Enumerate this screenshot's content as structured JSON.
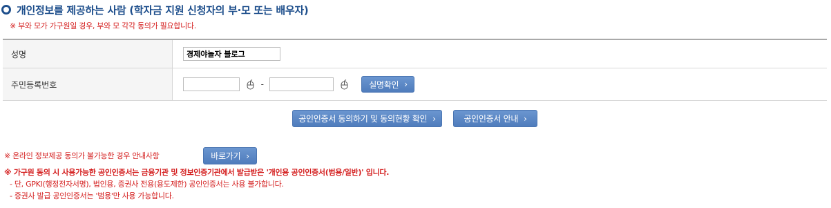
{
  "header": {
    "title": "개인정보를 제공하는 사람 (학자금 지원 신청자의 부·모 또는 배우자)",
    "note": "※ 부와 모가 가구원일 경우, 부와 모 각각 동의가 필요합니다."
  },
  "form": {
    "name_label": "성명",
    "name_value": "경제야놀자 블로그",
    "rrn_label": "주민등록번호",
    "rrn_separator": "-",
    "rrn_front": "",
    "rrn_back": "",
    "verify_button": "실명확인"
  },
  "actions": {
    "consent_button": "공인인증서 동의하기 및 동의현황 확인",
    "guide_button": "공인인증서 안내"
  },
  "offline": {
    "text": "※ 온라인 정보제공 동의가 불가능한 경우 안내사항",
    "goto_button": "바로가기"
  },
  "notes": {
    "main": "※ 가구원 동의 시 사용가능한 공인인증서는 금융기관 및 정보인증기관에서 발급받은 '개인용 공인인증서(범용/일반)' 입니다.",
    "sub1": "- 단, GPKI(행정전자서명), 법인용, 증권사 전용(용도제한) 공인인증서는 사용 불가합니다.",
    "sub2": "- 증권사 발급 공인인증서는 '범용'만 사용 가능합니다."
  },
  "colors": {
    "title": "#1e4f8c",
    "warning": "#d41e1e",
    "button": "#5b86c3"
  },
  "icons": {
    "mouse": "mouse-icon",
    "chevron": "chevron-right-icon",
    "bullet": "circle-bullet-icon"
  }
}
